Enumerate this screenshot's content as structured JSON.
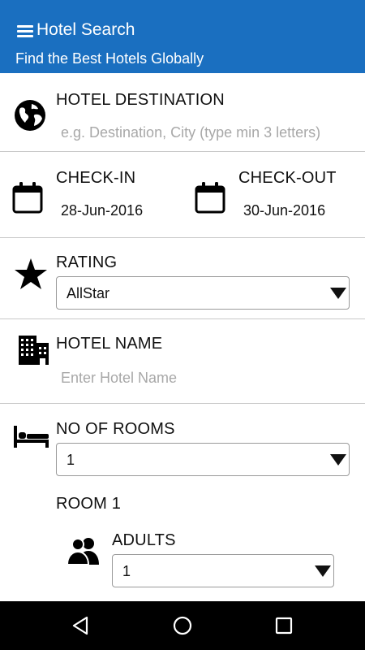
{
  "app": {
    "title": "Hotel Search",
    "subtitle": "Find the Best Hotels Globally",
    "theme_color": "#1a6fc0"
  },
  "destination": {
    "label": "HOTEL DESTINATION",
    "placeholder": "e.g. Destination, City (type min 3 letters)",
    "icon": "globe-icon"
  },
  "dates": {
    "checkin_label": "CHECK-IN",
    "checkin_value": "28-Jun-2016",
    "checkout_label": "CHECK-OUT",
    "checkout_value": "30-Jun-2016",
    "icon": "calendar-icon"
  },
  "rating": {
    "label": "RATING",
    "selected": "AllStar",
    "icon": "star-icon"
  },
  "hotel_name": {
    "label": "HOTEL NAME",
    "placeholder": "Enter Hotel Name",
    "icon": "building-icon"
  },
  "rooms": {
    "label": "NO OF ROOMS",
    "selected": "1",
    "icon": "bed-icon",
    "room_title": "ROOM 1",
    "adults_label": "ADULTS",
    "adults_selected": "1",
    "adults_icon": "people-icon"
  },
  "navbar": {
    "back_icon": "back-icon",
    "home_icon": "home-icon",
    "recents_icon": "recents-icon"
  }
}
